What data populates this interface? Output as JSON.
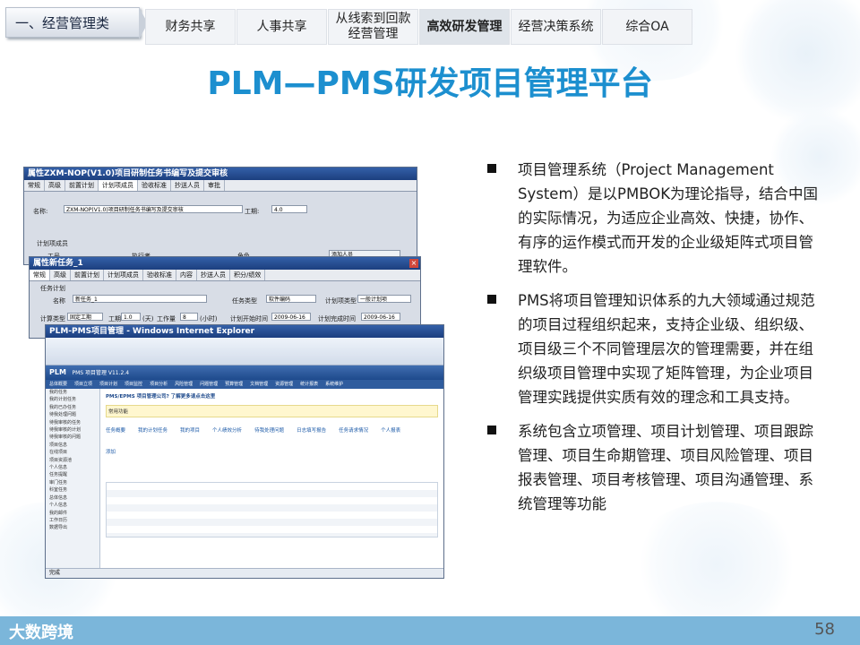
{
  "nav": {
    "section_label": "一、经营管理类",
    "tabs": [
      {
        "label": "财务共享",
        "active": false
      },
      {
        "label": "人事共享",
        "active": false
      },
      {
        "label": "从线索到回款\n经营管理",
        "active": false
      },
      {
        "label": "高效研发管理",
        "active": true
      },
      {
        "label": "经营决策系统",
        "active": false
      },
      {
        "label": "综合OA",
        "active": false
      }
    ]
  },
  "title": "PLM—PMS研发项目管理平台",
  "bullets": [
    "项目管理系统（Project Management System）是以PMBOK为理论指导，结合中国的实际情况，为适应企业高效、快捷，协作、有序的运作模式而开发的企业级矩阵式项目管理软件。",
    "PMS将项目管理知识体系的九大领域通过规范的项目过程组织起来，支持企业级、组织级、项目级三个不同管理层次的管理需要，并在组织级项目管理中实现了矩阵管理，为企业项目管理实践提供实质有效的理念和工具支持。",
    "系统包含立项管理、项目计划管理、项目跟踪管理、项目生命期管理、项目风险管理、项目报表管理、项目考核管理、项目沟通管理、系统管理等功能"
  ],
  "footer": {
    "logo": "大数跨境",
    "page_number": "58"
  },
  "screens": {
    "win1": {
      "title": "属性ZXM-NOP(V1.0)项目研制任务书编写及提交审核",
      "tabs": [
        "常规",
        "高级",
        "前置计划",
        "计划项成员",
        "验收标准",
        "抄送人员",
        "审批"
      ],
      "name_label": "名称:",
      "name_value": "ZXM-NOP(V1.0)项目研制任务书编写及提交审核",
      "work_label": "工期:",
      "work_value": "4.0",
      "members_label": "计划项成员",
      "add_button": "添加人员",
      "col_worker": "工号",
      "col_assignee": "执行者",
      "col_role": "角色"
    },
    "win2": {
      "title": "属性新任务_1",
      "tabs": [
        "常规",
        "高级",
        "前置计划",
        "计划项成员",
        "验收标准",
        "内容",
        "抄送人员",
        "积分/绩效"
      ],
      "section": "任务计划",
      "name_label": "名称",
      "name_value": "新任务_1",
      "type_label": "任务类型",
      "type_value": "软件编码",
      "plan_type_label": "计划项类型",
      "plan_type_value": "一般计划项",
      "calc_label": "计算类型",
      "calc_value": "固定工期",
      "duration_label": "工期",
      "duration_value": "1.0",
      "unit_day": "(天)",
      "workload_label": "工作量",
      "workload_value": "8",
      "unit_hour": "(小时)",
      "start_label": "计划开始时间",
      "start_value": "2009-06-16",
      "end_label": "计划完成时间",
      "end_value": "2009-06-16"
    },
    "win3": {
      "title": "PLM-PMS项目管理 - Windows Internet Explorer",
      "brand": "PLM",
      "product": "PMS 项目管理 V11.2.4",
      "menu": [
        "总体概要",
        "项目立项",
        "项目计划",
        "项目监控",
        "项目分析",
        "风险管理",
        "问题管理",
        "预算管理",
        "文档管理",
        "资源管理",
        "统计报表",
        "系统维护"
      ],
      "welcome": "PMS/EPMS 项目管理公司? 了解更多请点击这里",
      "common": "常用功能",
      "links": [
        "任务概要",
        "我的计划任务",
        "我的项目",
        "个人绩效分析",
        "待我处理问题",
        "日志填写报告",
        "任务请求情况",
        "个人报表"
      ],
      "add": "添加",
      "sidebar": [
        "我的任务",
        "我的计划任务",
        "我的已办任务",
        "待我处理问题",
        "待我审核的任务",
        "待我审核的计划",
        "待我审核的问题",
        "项目信息",
        "在线项目",
        "项目资源池",
        "个人信息",
        "任务提醒",
        "审门任务",
        "科室任务",
        "总体信息",
        "个人信息",
        "我的邮件",
        "工作日历",
        "数据导出"
      ],
      "status": "完成"
    }
  }
}
